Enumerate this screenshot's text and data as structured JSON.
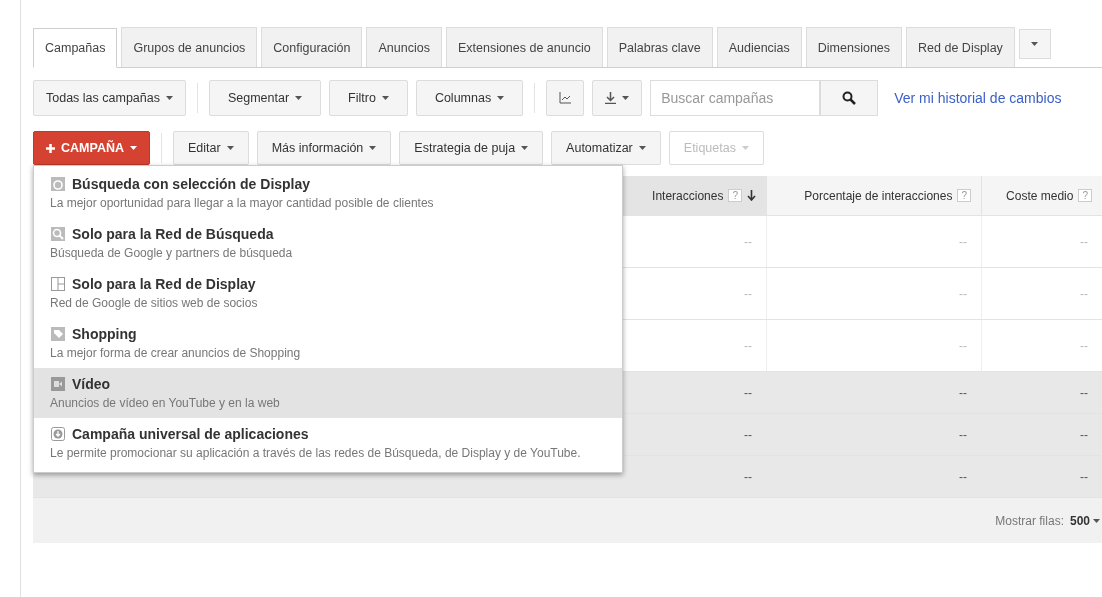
{
  "tabs": [
    {
      "label": "Campañas",
      "selected": true
    },
    {
      "label": "Grupos de anuncios",
      "selected": false
    },
    {
      "label": "Configuración",
      "selected": false
    },
    {
      "label": "Anuncios",
      "selected": false
    },
    {
      "label": "Extensiones de anuncio",
      "selected": false
    },
    {
      "label": "Palabras clave",
      "selected": false
    },
    {
      "label": "Audiencias",
      "selected": false
    },
    {
      "label": "Dimensiones",
      "selected": false
    },
    {
      "label": "Red de Display",
      "selected": false
    }
  ],
  "toolbar": {
    "scope": "Todas las campañas",
    "buttons": [
      "Segmentar",
      "Filtro",
      "Columnas"
    ],
    "search": {
      "placeholder": "Buscar campañas"
    },
    "link": "Ver mi historial de cambios"
  },
  "actions": {
    "primary": "CAMPAÑA",
    "buttons": [
      {
        "label": "Editar",
        "disabled": false
      },
      {
        "label": "Más información",
        "disabled": false
      },
      {
        "label": "Estrategia de puja",
        "disabled": false
      },
      {
        "label": "Automatizar",
        "disabled": false
      },
      {
        "label": "Etiquetas",
        "disabled": true
      }
    ]
  },
  "menu": [
    {
      "kind": "display-search",
      "title": "Búsqueda con selección de Display",
      "description": "La mejor oportunidad para llegar a la mayor cantidad posible de clientes",
      "selected": false
    },
    {
      "kind": "search",
      "title": "Solo para la Red de Búsqueda",
      "description": "Búsqueda de Google y partners de búsqueda",
      "selected": false
    },
    {
      "kind": "display",
      "title": "Solo para la Red de Display",
      "description": "Red de Google de sitios web de socios",
      "selected": false
    },
    {
      "kind": "shopping",
      "title": "Shopping",
      "description": "La mejor forma de crear anuncios de Shopping",
      "selected": false
    },
    {
      "kind": "video",
      "title": "Vídeo",
      "description": "Anuncios de vídeo en YouTube y en la web",
      "selected": true
    },
    {
      "kind": "app",
      "title": "Campaña universal de aplicaciones",
      "description": "Le permite promocionar su aplicación a través de las redes de Búsqueda, de Display y de YouTube.",
      "selected": false
    }
  ],
  "table": {
    "columns": [
      {
        "label": "Interacciones",
        "help": "?",
        "sorted": true
      },
      {
        "label": "Porcentaje de interacciones",
        "help": "?",
        "sorted": false
      },
      {
        "label": "Coste medio",
        "help": "?",
        "sorted": false
      }
    ],
    "rows": [
      {
        "kind": "campaign",
        "cells": [
          "--",
          "--",
          "--"
        ]
      },
      {
        "kind": "campaign",
        "cells": [
          "--",
          "--",
          "--"
        ]
      },
      {
        "kind": "campaign",
        "cells": [
          "--",
          "--",
          "--"
        ]
      },
      {
        "kind": "total",
        "cells": [
          "--",
          "--",
          "--"
        ]
      },
      {
        "kind": "total",
        "cells": [
          "--",
          "--",
          "--"
        ]
      },
      {
        "kind": "total",
        "cells": [
          "--",
          "--",
          "--"
        ]
      }
    ],
    "footer": {
      "label": "Mostrar filas:",
      "value": "500"
    }
  }
}
